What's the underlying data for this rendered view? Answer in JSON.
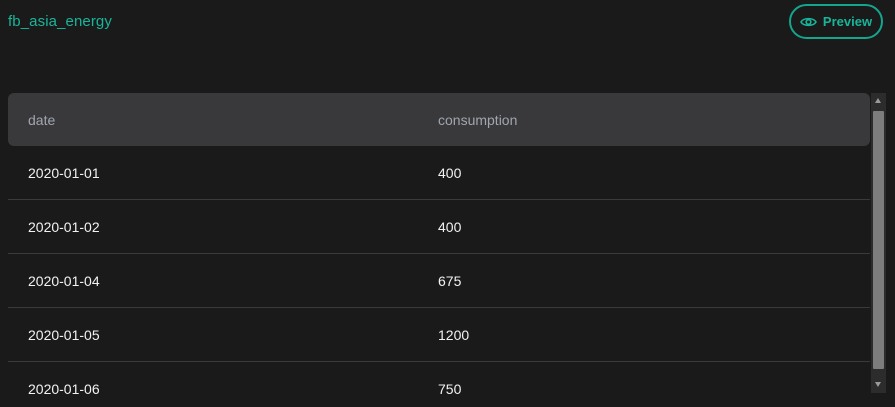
{
  "header": {
    "title": "fb_asia_energy",
    "preview_label": "Preview",
    "preview_icon": "eye-icon"
  },
  "colors": {
    "accent": "#17b59a",
    "background": "#1b1a1a",
    "header_row": "#39393b"
  },
  "table": {
    "columns": [
      "date",
      "consumption"
    ],
    "rows": [
      [
        "2020-01-01",
        "400"
      ],
      [
        "2020-01-02",
        "400"
      ],
      [
        "2020-01-04",
        "675"
      ],
      [
        "2020-01-05",
        "1200"
      ],
      [
        "2020-01-06",
        "750"
      ]
    ]
  }
}
